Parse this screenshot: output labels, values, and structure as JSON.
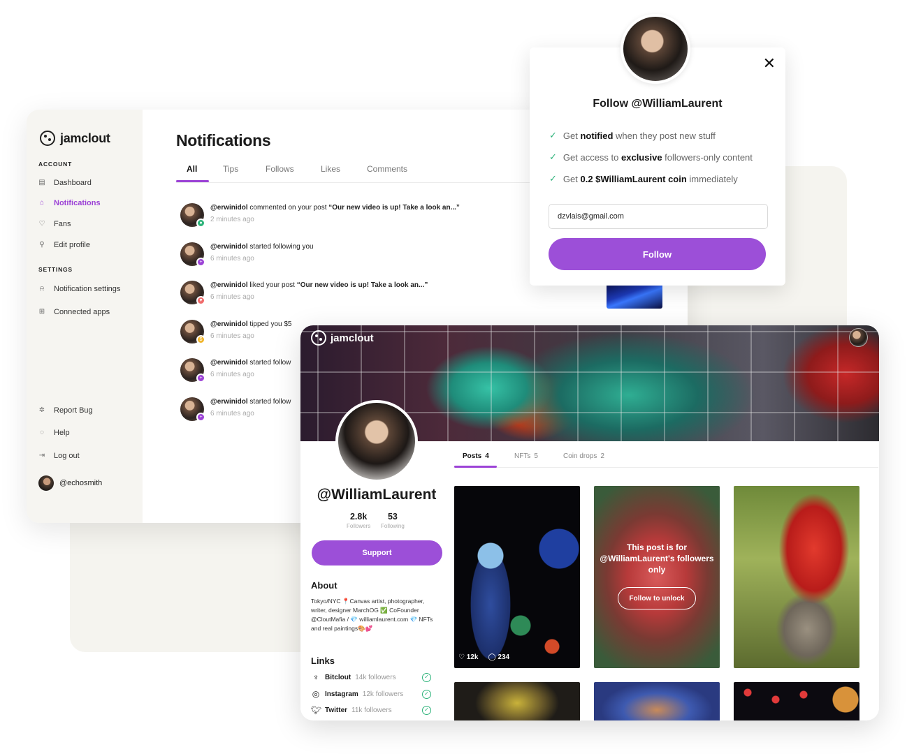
{
  "dashboard": {
    "brand": "jamclout",
    "sidebar": {
      "account_heading": "ACCOUNT",
      "settings_heading": "SETTINGS",
      "items": [
        {
          "label": "Dashboard",
          "icon": "dashboard-icon"
        },
        {
          "label": "Notifications",
          "icon": "bell-icon",
          "active": true
        },
        {
          "label": "Fans",
          "icon": "heart-icon"
        },
        {
          "label": "Edit profile",
          "icon": "user-icon"
        },
        {
          "label": "Notification settings",
          "icon": "bell-settings-icon"
        },
        {
          "label": "Connected apps",
          "icon": "grid-icon"
        },
        {
          "label": "Report Bug",
          "icon": "bug-icon"
        },
        {
          "label": "Help",
          "icon": "help-icon"
        },
        {
          "label": "Log out",
          "icon": "logout-icon"
        }
      ],
      "user_handle": "@echosmith"
    },
    "title": "Notifications",
    "tabs": [
      "All",
      "Tips",
      "Follows",
      "Likes",
      "Comments"
    ],
    "active_tab": "All",
    "notifications": [
      {
        "user": "@erwinidol",
        "action": " commented on your post ",
        "quote": "“Our new video is up! Take a look an...”",
        "time": "2 minutes ago",
        "badge_color": "#2db37a",
        "badge": "comment-icon"
      },
      {
        "user": "@erwinidol",
        "action": " started following you",
        "quote": "",
        "time": "6 minutes ago",
        "badge_color": "#9c43d6",
        "badge": "plus-icon"
      },
      {
        "user": "@erwinidol",
        "action": " liked your post ",
        "quote": "“Our new video is up! Take a look an...”",
        "time": "6 minutes ago",
        "badge_color": "#f06a6a",
        "badge": "heart-icon"
      },
      {
        "user": "@erwinidol",
        "action": " tipped you $5",
        "quote": "",
        "time": "6 minutes ago",
        "badge_color": "#f0b429",
        "badge": "dollar-icon"
      },
      {
        "user": "@erwinidol",
        "action": " started follow",
        "quote": "",
        "time": "6 minutes ago",
        "badge_color": "#9c43d6",
        "badge": "plus-icon"
      },
      {
        "user": "@erwinidol",
        "action": " started follow",
        "quote": "",
        "time": "6 minutes ago",
        "badge_color": "#9c43d6",
        "badge": "plus-icon"
      }
    ]
  },
  "follow_modal": {
    "title": "Follow @WilliamLaurent",
    "benefits": [
      {
        "pre": "Get ",
        "bold": "notified",
        "post": " when they post new stuff"
      },
      {
        "pre": "Get access to ",
        "bold": "exclusive",
        "post": " followers-only content"
      },
      {
        "pre": "Get ",
        "bold": "0.2 $WilliamLaurent coin",
        "post": " immediately"
      }
    ],
    "email_value": "dzvlais@gmail.com",
    "button_label": "Follow",
    "close_icon": "close-icon"
  },
  "profile": {
    "brand": "jamclout",
    "handle": "@WilliamLaurent",
    "followers_count": "2.8k",
    "followers_label": "Followers",
    "following_count": "53",
    "following_label": "Following",
    "support_label": "Support",
    "about_heading": "About",
    "about_text": "Tokyo/NYC 📍Canvas artist, photographer, writer, designer MarchOG ✅ CoFounder @CloutMafia / 💎 williamlaurent.com 💎 NFTs and real paintings🎨💕",
    "links_heading": "Links",
    "links": [
      {
        "name": "Bitclout",
        "count": "14k followers",
        "icon": "bitclout-icon"
      },
      {
        "name": "Instagram",
        "count": "12k followers",
        "icon": "instagram-icon"
      },
      {
        "name": "Twitter",
        "count": "11k followers",
        "icon": "twitter-icon"
      }
    ],
    "tabs": [
      {
        "label": "Posts",
        "count": "4",
        "active": true
      },
      {
        "label": "NFTs",
        "count": "5"
      },
      {
        "label": "Coin drops",
        "count": "2"
      }
    ],
    "post1_likes": "12k",
    "post1_comments": "234",
    "locked_text": "This post is for @WilliamLaurent's followers only",
    "unlock_label": "Follow to unlock"
  },
  "colors": {
    "accent": "#9c43d6",
    "button": "#9c4fd8",
    "success": "#2db37a"
  }
}
